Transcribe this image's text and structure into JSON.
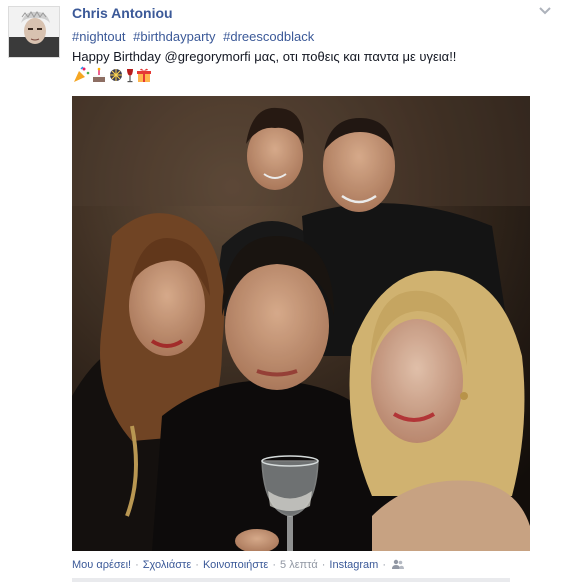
{
  "post": {
    "author": "Chris Antoniou",
    "hashtags": [
      "#nightout",
      "#birthdayparty",
      "#dreescodblack"
    ],
    "message": "Happy Birthday @gregorymorfi μας, οτι ποθεις και παντα με υγεια!!",
    "emojis": [
      "party-popper-icon",
      "cake-icon",
      "fireworks-icon",
      "wine-glass-icon",
      "gift-icon"
    ]
  },
  "actions": {
    "like": "Μου αρέσει!",
    "comment": "Σχολιάστε",
    "share": "Κοινοποιήστε",
    "time": "5 λεπτά",
    "source": "Instagram",
    "separator": "·"
  },
  "colors": {
    "link": "#3b5998",
    "meta": "#9197a3",
    "text": "#141823"
  }
}
